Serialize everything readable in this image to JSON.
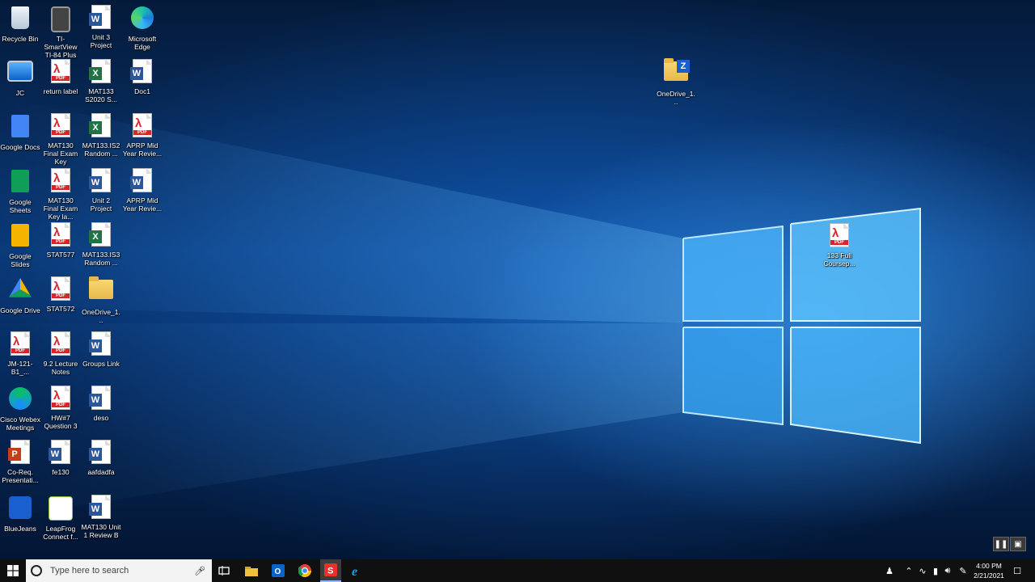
{
  "desktop": {
    "icons": [
      {
        "label": "Recycle Bin",
        "icon": "recycle-bin-icon"
      },
      {
        "label": "TI-SmartView TI-84 Plus",
        "icon": "calculator-icon"
      },
      {
        "label": "Unit 3 Project",
        "icon": "word-doc-icon"
      },
      {
        "label": "Microsoft Edge",
        "icon": "edge-icon"
      },
      {
        "label": "JC",
        "icon": "computer-icon"
      },
      {
        "label": "return label",
        "icon": "pdf-icon"
      },
      {
        "label": "MAT133 S2020 S...",
        "icon": "excel-icon"
      },
      {
        "label": "Doc1",
        "icon": "word-doc-icon"
      },
      {
        "label": "Google Docs",
        "icon": "google-docs-icon"
      },
      {
        "label": "MAT130 Final Exam Key",
        "icon": "pdf-icon"
      },
      {
        "label": "MAT133.IS2 Random ...",
        "icon": "excel-icon"
      },
      {
        "label": "APRP Mid Year Revie...",
        "icon": "pdf-icon"
      },
      {
        "label": "Google Sheets",
        "icon": "google-sheets-icon"
      },
      {
        "label": "MAT130 Final Exam Key la...",
        "icon": "pdf-icon"
      },
      {
        "label": "Unit 2 Project",
        "icon": "word-doc-icon"
      },
      {
        "label": "APRP Mid Year Revie...",
        "icon": "word-doc-icon"
      },
      {
        "label": "Google Slides",
        "icon": "google-slides-icon"
      },
      {
        "label": "STAT577",
        "icon": "pdf-icon"
      },
      {
        "label": "MAT133.IS3 Random ...",
        "icon": "excel-icon"
      },
      {
        "label": "Google Drive",
        "icon": "google-drive-icon"
      },
      {
        "label": "STAT572",
        "icon": "pdf-icon"
      },
      {
        "label": "OneDrive_1...",
        "icon": "folder-icon"
      },
      {
        "label": "JM-121-B1_...",
        "icon": "pdf-icon"
      },
      {
        "label": "9.2 Lecture Notes",
        "icon": "pdf-icon"
      },
      {
        "label": "Groups Link",
        "icon": "word-doc-icon"
      },
      {
        "label": "Cisco Webex Meetings",
        "icon": "webex-icon"
      },
      {
        "label": "HW#7 Question 3",
        "icon": "pdf-icon"
      },
      {
        "label": "deso",
        "icon": "word-doc-icon"
      },
      {
        "label": "Co-Req. Presentati...",
        "icon": "powerpoint-icon"
      },
      {
        "label": "fe130",
        "icon": "word-doc-icon"
      },
      {
        "label": "aafdadfa",
        "icon": "word-doc-icon"
      },
      {
        "label": "BlueJeans",
        "icon": "bluejeans-icon"
      },
      {
        "label": "LeapFrog Connect f...",
        "icon": "leapfrog-icon"
      },
      {
        "label": "MAT130 Unit 1 Review B",
        "icon": "word-doc-icon"
      },
      {
        "label": "OneDrive_1...",
        "icon": "zip-folder-icon"
      },
      {
        "label": "133 Full Coursep...",
        "icon": "pdf-icon"
      }
    ]
  },
  "taskbar": {
    "search_placeholder": "Type here to search",
    "clock_time": "4:00 PM",
    "clock_date": "2/21/2021",
    "pinned": [
      "task-view-icon",
      "file-explorer-icon",
      "outlook-icon",
      "chrome-icon",
      "snagit-icon",
      "internet-explorer-icon"
    ]
  },
  "recording_controls": [
    "pause-icon",
    "screen-icon"
  ],
  "colors": {
    "accent": "#1e90ff",
    "taskbar": "#101010",
    "pdf_red": "#d8252b",
    "word_blue": "#2b579a",
    "excel_green": "#217346"
  }
}
